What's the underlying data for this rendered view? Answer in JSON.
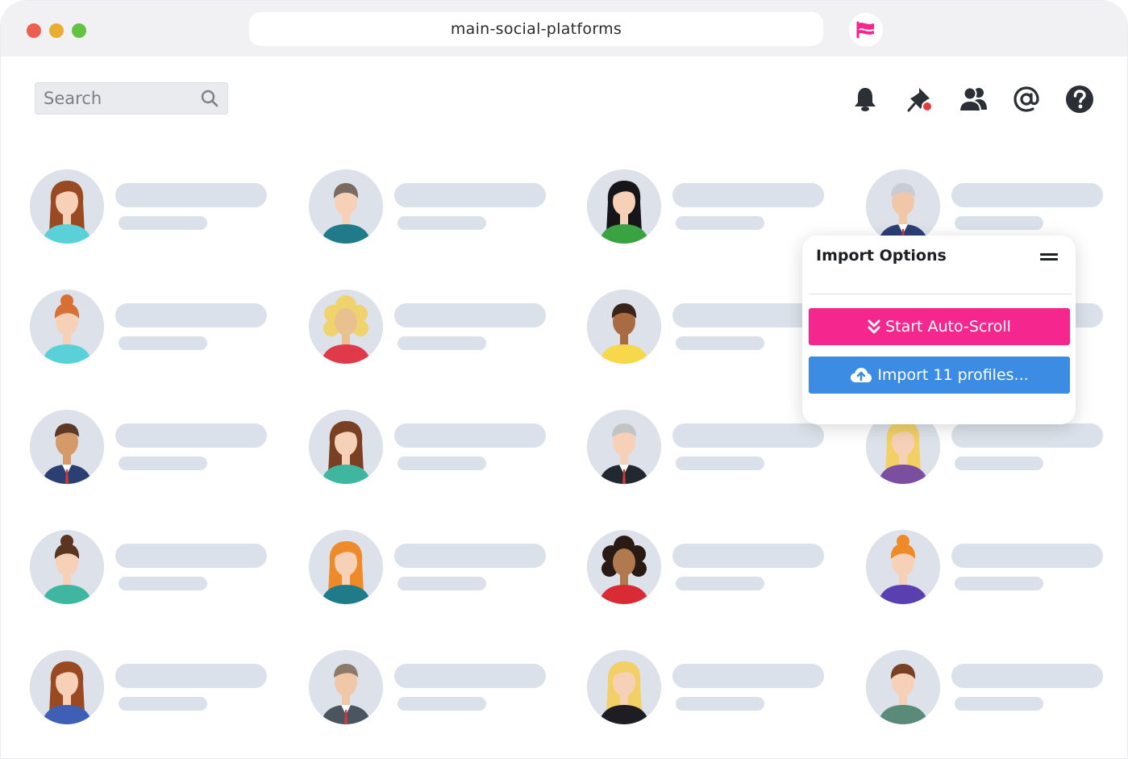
{
  "browser": {
    "url": "main-social-platforms"
  },
  "search": {
    "placeholder": "Search"
  },
  "toolbar": {
    "icons": [
      "bell-icon",
      "pin-icon",
      "users-icon",
      "at-icon",
      "help-icon"
    ]
  },
  "profiles": [
    {
      "hair": "#9a4a22",
      "skin": "#f6d1b7",
      "shirt": "#5ad1d9",
      "style": "long"
    },
    {
      "hair": "#7a6a60",
      "skin": "#f6d1b7",
      "shirt": "#1f7b8a",
      "style": "short"
    },
    {
      "hair": "#15151a",
      "skin": "#f6d1b7",
      "shirt": "#3aa241",
      "style": "long"
    },
    {
      "hair": "#c9ccd2",
      "skin": "#f0c8a8",
      "shirt": "#2b3f73",
      "style": "suit"
    },
    {
      "hair": "#d86f34",
      "skin": "#f6d1b7",
      "shirt": "#5ad1d9",
      "style": "bun"
    },
    {
      "hair": "#f0d36c",
      "skin": "#e9c18f",
      "shirt": "#e03a4a",
      "style": "curly"
    },
    {
      "hair": "#3a241a",
      "skin": "#a86b42",
      "shirt": "#f7d84a",
      "style": "short"
    },
    {
      "hair": "#cdd2d9",
      "skin": "#f6d1b7",
      "shirt": "#2b3f73",
      "style": "suit"
    },
    {
      "hair": "#5a3a26",
      "skin": "#d49a6a",
      "shirt": "#2b3f73",
      "style": "suit"
    },
    {
      "hair": "#7a4024",
      "skin": "#f6d1b7",
      "shirt": "#3fb7a0",
      "style": "long"
    },
    {
      "hair": "#c3c3c3",
      "skin": "#f6d1b7",
      "shirt": "#222830",
      "style": "suit"
    },
    {
      "hair": "#f2d066",
      "skin": "#f6d1b7",
      "shirt": "#7b4fa0",
      "style": "long"
    },
    {
      "hair": "#5a3520",
      "skin": "#f6d1b7",
      "shirt": "#3fb7a0",
      "style": "bun"
    },
    {
      "hair": "#ee8a2a",
      "skin": "#f6d1b7",
      "shirt": "#1f7b8a",
      "style": "long"
    },
    {
      "hair": "#2a1a14",
      "skin": "#b07a4e",
      "shirt": "#d92b36",
      "style": "curly"
    },
    {
      "hair": "#ee8a2a",
      "skin": "#f6d1b7",
      "shirt": "#5a3fb0",
      "style": "bun"
    },
    {
      "hair": "#9a4a22",
      "skin": "#f6d1b7",
      "shirt": "#3f5fb7",
      "style": "long"
    },
    {
      "hair": "#8c7a6a",
      "skin": "#f0c8a8",
      "shirt": "#4a5560",
      "style": "suit"
    },
    {
      "hair": "#f2d066",
      "skin": "#f6d1b7",
      "shirt": "#1d1d22",
      "style": "long"
    },
    {
      "hair": "#7a4024",
      "skin": "#f6d1b7",
      "shirt": "#5a8a78",
      "style": "short"
    }
  ],
  "import_panel": {
    "title": "Import Options",
    "autoscroll_label": "Start Auto-Scroll",
    "import_label": "Import 11 profiles...",
    "colors": {
      "autoscroll": "#f5268d",
      "import": "#3d8ce3"
    }
  }
}
